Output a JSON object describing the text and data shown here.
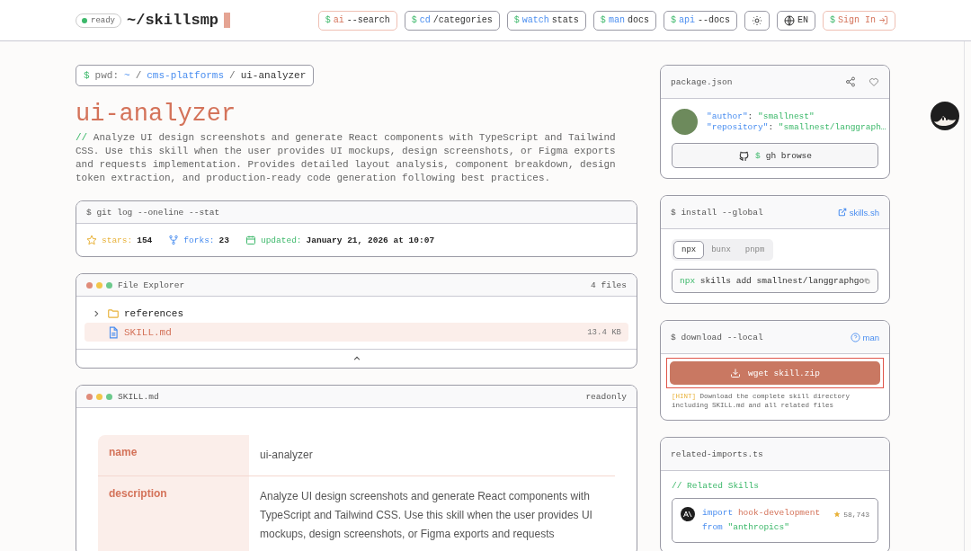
{
  "header": {
    "status": {
      "label": "ready",
      "on": true
    },
    "logo": "~/skillsmp",
    "nav": [
      {
        "kind": "primary",
        "prompt": "$",
        "cmd": "ai",
        "arg": "--search"
      },
      {
        "kind": "default",
        "prompt": "$",
        "cmd": "cd",
        "arg": "/categories"
      },
      {
        "kind": "default",
        "prompt": "$",
        "cmd": "watch",
        "arg": "stats"
      },
      {
        "kind": "default",
        "prompt": "$",
        "cmd": "man",
        "arg": "docs"
      },
      {
        "kind": "default",
        "prompt": "$",
        "cmd": "api",
        "arg": "--docs"
      }
    ],
    "language": "EN",
    "sign_in": {
      "prompt": "$",
      "label": "Sign In"
    }
  },
  "breadcrumb": {
    "prompt": "$",
    "label": "pwd:",
    "separator": "/",
    "parts": [
      {
        "text": "~",
        "link": true
      },
      {
        "text": "cms-platforms",
        "link": true
      },
      {
        "text": "ui-analyzer",
        "link": false
      }
    ]
  },
  "title": "ui-analyzer",
  "description": {
    "prefix": "//",
    "text": "Analyze UI design screenshots and generate React components with TypeScript and Tailwind CSS. Use this skill when the user provides UI mockups, design screenshots, or Figma exports and requests implementation. Provides detailed layout analysis, component breakdown, design token extraction, and production-ready code generation following best practices."
  },
  "git_log": {
    "command": "$ git log --oneline --stat",
    "stats": [
      {
        "kind": "stars",
        "label": "stars:",
        "value": "154"
      },
      {
        "kind": "forks",
        "label": "forks:",
        "value": "23"
      },
      {
        "kind": "updated",
        "label": "updated:",
        "value": "January 21, 2026 at 10:07"
      }
    ]
  },
  "file_explorer": {
    "title": "File Explorer",
    "count": "4 files",
    "items": [
      {
        "kind": "folder",
        "name": "references",
        "expanded": false,
        "selected": false
      },
      {
        "kind": "file",
        "name": "SKILL.md",
        "size": "13.4 KB",
        "selected": true
      }
    ]
  },
  "skill_md": {
    "title": "SKILL.md",
    "mode": "readonly",
    "fields": [
      {
        "key": "name",
        "value": "ui-analyzer"
      },
      {
        "key": "description",
        "value": "Analyze UI design screenshots and generate React components with TypeScript and Tailwind CSS. Use this skill when the user provides UI mockups, design screenshots, or Figma exports and requests"
      }
    ]
  },
  "package": {
    "title": "package.json",
    "meta": [
      {
        "key": "\"author\"",
        "value": "\"smallnest\""
      },
      {
        "key": "\"repository\"",
        "value": "\"smallnest/langgraph…"
      }
    ],
    "separator": ":",
    "button": {
      "prompt": "$",
      "label": "gh browse"
    }
  },
  "install": {
    "title": "$ install --global",
    "link": "skills.sh",
    "tabs": [
      {
        "label": "npx",
        "selected": true
      },
      {
        "label": "bunx",
        "selected": false
      },
      {
        "label": "pnpm",
        "selected": false
      }
    ],
    "command": {
      "prefix": "npx",
      "text": "skills add smallnest/langgraphgo"
    }
  },
  "download": {
    "title": "$ download --local",
    "link": "man",
    "button": "wget skill.zip",
    "hint": {
      "tag": "[HINT]",
      "text": "Download the complete skill directory including SKILL.md and all related files"
    }
  },
  "related": {
    "title": "related-imports.ts",
    "heading": "// Related Skills",
    "items": [
      {
        "keyword": "import",
        "name": "hook-development",
        "from": "from",
        "source": "\"anthropics\"",
        "stars": "58,743"
      }
    ]
  }
}
